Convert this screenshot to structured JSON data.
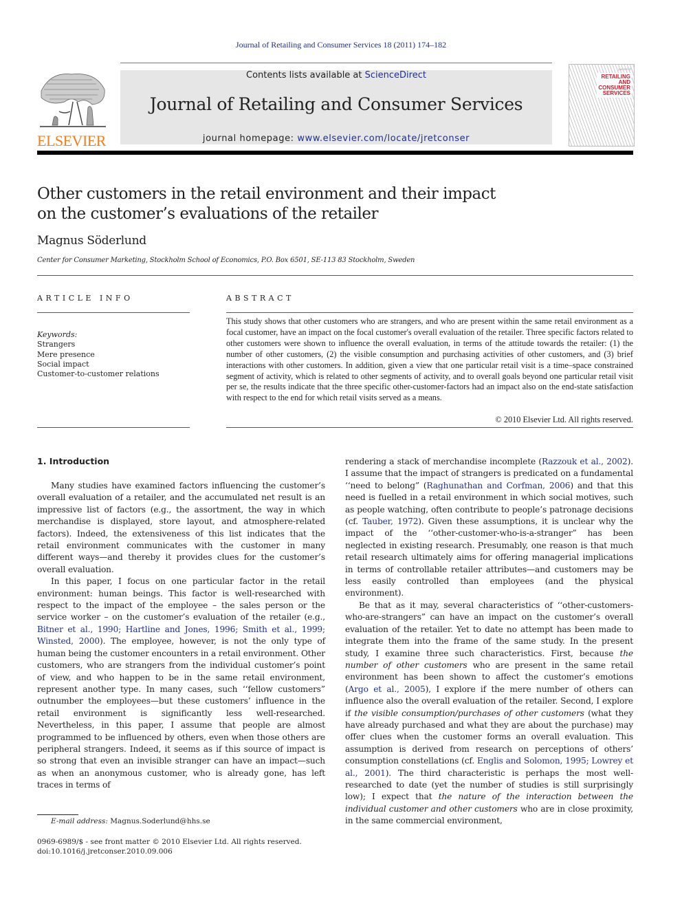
{
  "running_head": "Journal of Retailing and Consumer Services 18 (2011) 174–182",
  "header": {
    "publisher_logo_text": "ELSEVIER",
    "contents_prefix": "Contents lists available at ",
    "contents_link": "ScienceDirect",
    "journal_title": "Journal of Retailing and Consumer Services",
    "homepage_prefix": "journal homepage: ",
    "homepage_link": "www.elsevier.com/locate/jretconser",
    "cover": {
      "small_text": "journal of",
      "title_lines": [
        "RETAILING",
        "AND",
        "CONSUMER",
        "SERVICES"
      ]
    }
  },
  "article": {
    "title_line1": "Other customers in the retail environment and their impact",
    "title_line2": "on the customer’s evaluations of the retailer",
    "author": "Magnus Söderlund",
    "affiliation": "Center for Consumer Marketing, Stockholm School of Economics, P.O. Box 6501, SE-113 83 Stockholm, Sweden"
  },
  "article_info": {
    "heading": "ARTICLE INFO",
    "keywords_label": "Keywords:",
    "keywords": [
      "Strangers",
      "Mere presence",
      "Social impact",
      "Customer-to-customer relations"
    ]
  },
  "abstract": {
    "heading": "ABSTRACT",
    "body": "This study shows that other customers who are strangers, and who are present within the same retail environment as a focal customer, have an impact on the focal customer's overall evaluation of the retailer. Three specific factors related to other customers were shown to influence the overall evaluation, in terms of the attitude towards the retailer: (1) the number of other customers, (2) the visible consumption and purchasing activities of other customers, and (3) brief interactions with other customers. In addition, given a view that one particular retail visit is a time–space constrained segment of activity, which is related to other segments of activity, and to overall goals beyond one particular retail visit per se, the results indicate that the three specific other-customer-factors had an impact also on the end-state satisfaction with respect to the end for which retail visits served as a means.",
    "copyright": "© 2010 Elsevier Ltd. All rights reserved."
  },
  "body": {
    "section_heading": "1.  Introduction",
    "left": {
      "p1": "Many studies have examined factors influencing the customer’s overall evaluation of a retailer, and the accumulated net result is an impressive list of factors (e.g., the assortment, the way in which merchandise is displayed, store layout, and atmosphere-related factors). Indeed, the extensiveness of this list indicates that the retail environment communicates with the customer in many different ways—and thereby it provides clues for the customer’s overall evaluation.",
      "p2_a": "In this paper, I focus on one particular factor in the retail environment: human beings. This factor is well-researched with respect to the impact of the employee – the sales person or the service worker – on the customer’s evaluation of the retailer (e.g., ",
      "p2_cite": "Bitner et al., 1990; Hartline and Jones, 1996; Smith et al., 1999; Winsted, 2000",
      "p2_b": "). The employee, however, is not the only type of human being the customer encounters in a retail environment. Other customers, who are strangers from the individual customer’s point of view, and who happen to be in the same retail environment, represent another type. In many cases, such ‘‘fellow customers” outnumber the employees—but these customers’ influence in the retail environment is significantly less well-researched. Nevertheless, in this paper, I assume that people are almost programmed to be influenced by others, even when those others are peripheral strangers. Indeed, it seems as if this source of impact is so strong that even an invisible stranger can have an impact—such as when an anonymous customer, who is already gone, has left traces in terms of"
    },
    "right": {
      "p1_a": "rendering a stack of merchandise incomplete (",
      "p1_cite1": "Razzouk et al., 2002",
      "p1_b": "). I assume that the impact of strangers is predicated on a fundamental ‘‘need to belong” (",
      "p1_cite2": "Raghunathan and Corfman, 2006",
      "p1_c": ") and that this need is fuelled in a retail environment in which social motives, such as people watching, often contribute to people’s patronage decisions (cf. ",
      "p1_cite3": "Tauber, 1972",
      "p1_d": "). Given these assumptions, it is unclear why the impact of the ‘‘other-customer-who-is-a-stranger” has been neglected in existing research. Presumably, one reason is that much retail research ultimately aims for offering managerial implications in terms of controllable retailer attributes—and customers may be less easily controlled than employees (and the physical environment).",
      "p2_a": "Be that as it may, several characteristics of ‘‘other-customers-who-are-strangers” can have an impact on the customer’s overall evaluation of the retailer. Yet to date no attempt has been made to integrate them into the frame of the same study. In the present study, I examine three such characteristics. First, because ",
      "p2_em1": "the number of other customers",
      "p2_b": " who are present in the same retail environment has been shown to affect the customer’s emotions (",
      "p2_cite1": "Argo et al., 2005",
      "p2_c": "), I explore if the mere number of others can influence also the overall evaluation of the retailer. Second, I explore if ",
      "p2_em2": "the visible consumption/purchases of other customers",
      "p2_d": " (what they have already purchased and what they are about the purchase) may offer clues when the customer forms an overall evaluation. This assumption is derived from research on perceptions of others’ consumption constellations (cf. ",
      "p2_cite2": "Englis and Solomon, 1995; Lowrey et al., 2001",
      "p2_e": "). The third characteristic is perhaps the most well-researched to date (yet the number of studies is still surprisingly low); I expect that ",
      "p2_em3": "the nature of the interaction between the individual customer and other customers",
      "p2_f": " who are in close proximity, in the same commercial environment,"
    }
  },
  "footer": {
    "email_label": "E-mail address:",
    "email": " Magnus.Soderlund@hhs.se",
    "front_matter": "0969-6989/$ - see front matter © 2010 Elsevier Ltd. All rights reserved.",
    "doi": "doi:10.1016/j.jretconser.2010.09.006"
  },
  "colors": {
    "link": "#1f2f8a",
    "elsevier_orange": "#f07e1b",
    "cover_red": "#c81e2c",
    "band_gray": "#e6e6e6"
  }
}
